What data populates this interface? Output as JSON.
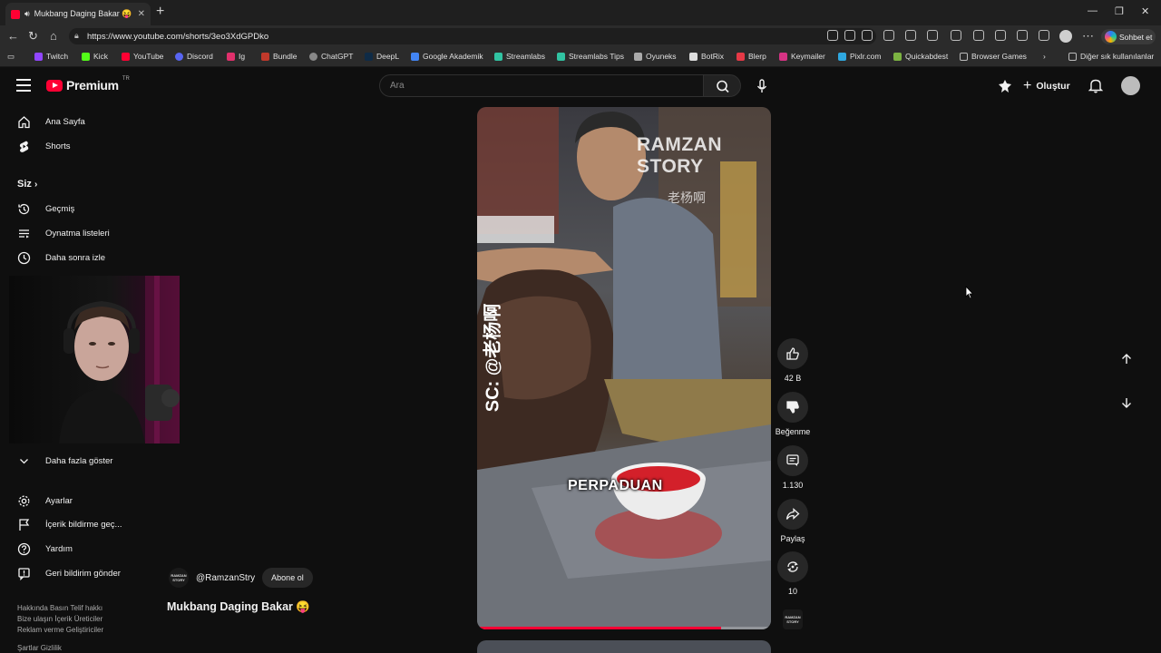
{
  "browser": {
    "tab_title": "Mukbang Daging Bakar 😝 - YouTube",
    "url": "https://www.youtube.com/shorts/3eo3XdGPDko",
    "copilot_label": "Sohbet et",
    "bookmarks": [
      "Twitch",
      "Kick",
      "YouTube",
      "Discord",
      "Ig",
      "Bundle",
      "ChatGPT",
      "DeepL",
      "Google Akademik",
      "Streamlabs",
      "Streamlabs Tips",
      "Oyuneks",
      "BotRix",
      "Blerp",
      "Keymailer",
      "Pixlr.com",
      "Quickabdest",
      "Browser Games"
    ],
    "other_bookmarks": "Diğer sık kullanılanlar"
  },
  "youtube": {
    "logo_text": "Premium",
    "logo_country": "TR",
    "search_placeholder": "Ara",
    "create_label": "Oluştur",
    "sidebar": {
      "home": "Ana Sayfa",
      "shorts": "Shorts",
      "you": "Siz",
      "history": "Geçmiş",
      "playlists": "Oynatma listeleri",
      "watch_later": "Daha sonra izle",
      "show_more": "Daha fazla göster",
      "settings": "Ayarlar",
      "report_history": "İçerik bildirme geç...",
      "help": "Yardım",
      "feedback": "Geri bildirim gönder"
    },
    "footer": {
      "row1": "Hakkında  Basın  Telif hakkı",
      "row2": "Bize ulaşın  İçerik Üreticiler",
      "row3": "Reklam verme  Geliştiriciler",
      "row4": "Şartlar  Gizlilik"
    },
    "short": {
      "caption": "PERPADUAN",
      "watermark": "RAMZAN STORY",
      "watermark_cn": "老杨啊",
      "side_text": "SC: @老杨啊",
      "progress": 0.83,
      "channel_avatar": "RAMZAN STORY",
      "channel_name": "@RamzanStry",
      "subscribe_label": "Abone ol",
      "title": "Mukbang Daging Bakar 😝"
    },
    "actions": {
      "likes": "42 B",
      "dislike": "Beğenme",
      "comments": "1.130",
      "share": "Paylaş",
      "remix": "10"
    }
  }
}
